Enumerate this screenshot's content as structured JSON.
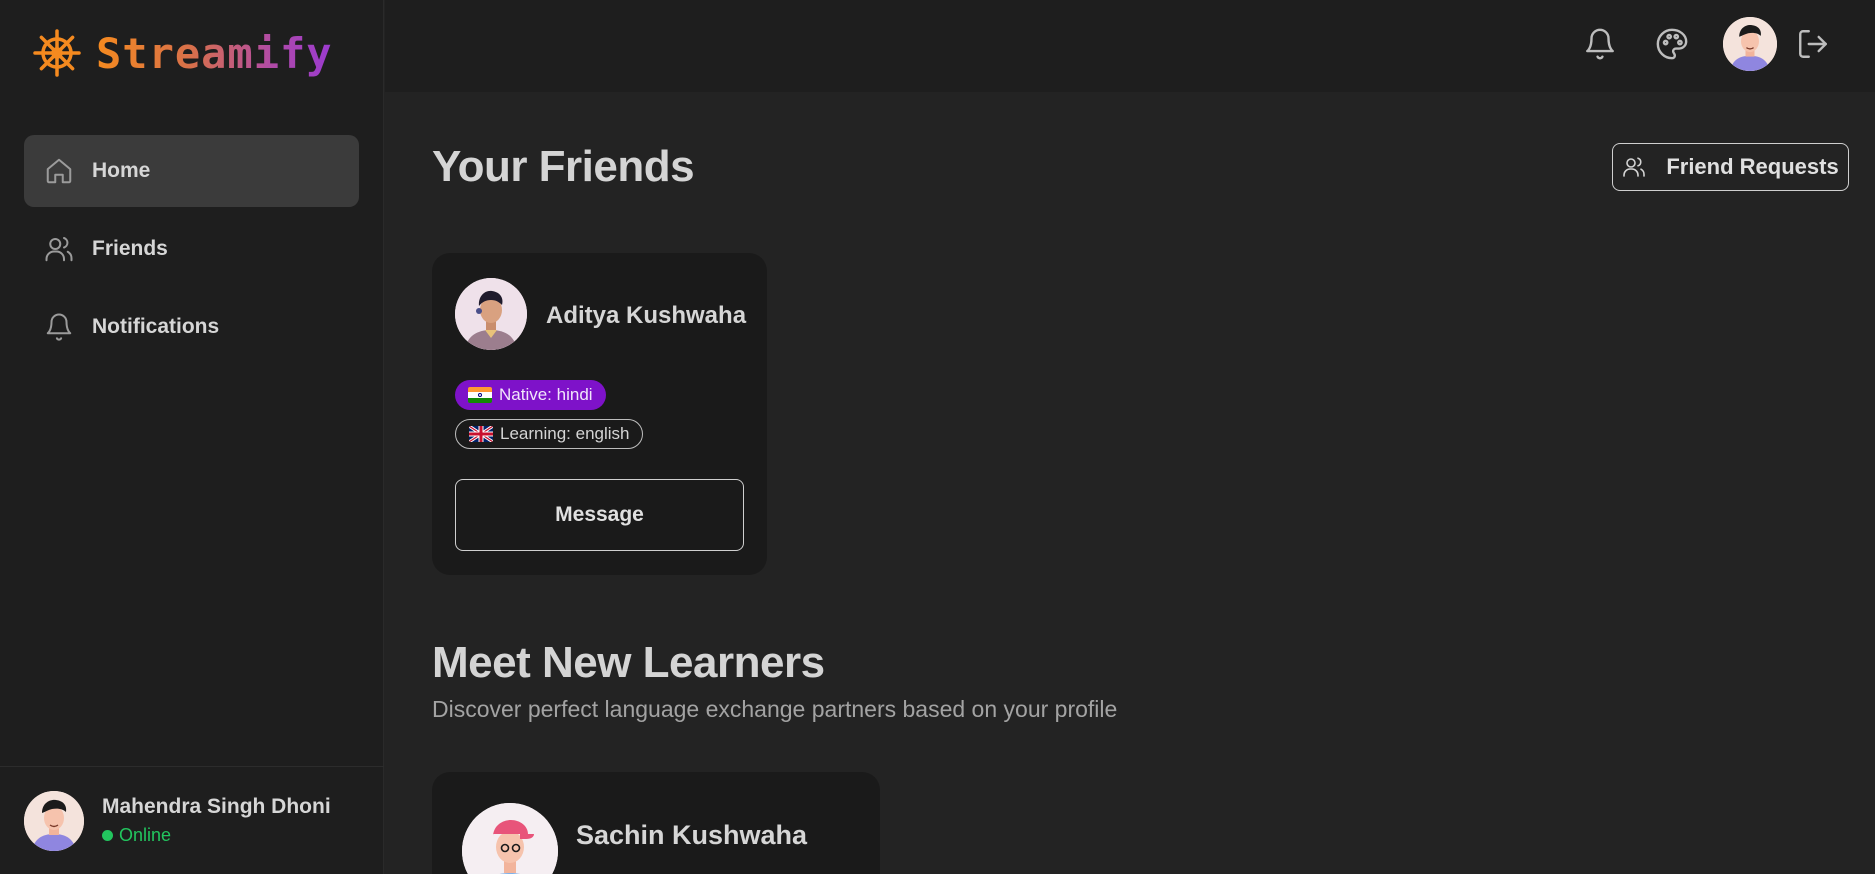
{
  "brand": {
    "name": "Streamify",
    "logo_icon": "ship-wheel-icon"
  },
  "sidebar": {
    "items": [
      {
        "label": "Home",
        "icon": "home-icon",
        "active": true
      },
      {
        "label": "Friends",
        "icon": "users-icon",
        "active": false
      },
      {
        "label": "Notifications",
        "icon": "bell-icon",
        "active": false
      }
    ],
    "user": {
      "name": "Mahendra Singh Dhoni",
      "status": "Online"
    }
  },
  "topbar": {
    "icons": [
      "bell-icon",
      "palette-icon",
      "avatar",
      "logout-icon"
    ]
  },
  "friends_section": {
    "title": "Your Friends",
    "requests_button": "Friend Requests",
    "friends": [
      {
        "name": "Aditya Kushwaha",
        "native_label": "Native: hindi",
        "learning_label": "Learning: english",
        "message_button": "Message"
      }
    ]
  },
  "learners_section": {
    "title": "Meet New Learners",
    "subtitle": "Discover perfect language exchange partners based on your profile",
    "learners": [
      {
        "name": "Sachin Kushwaha"
      }
    ]
  },
  "colors": {
    "accent_purple": "#7e12c9",
    "online_green": "#22c55e",
    "brand_orange": "#f58a1f"
  }
}
